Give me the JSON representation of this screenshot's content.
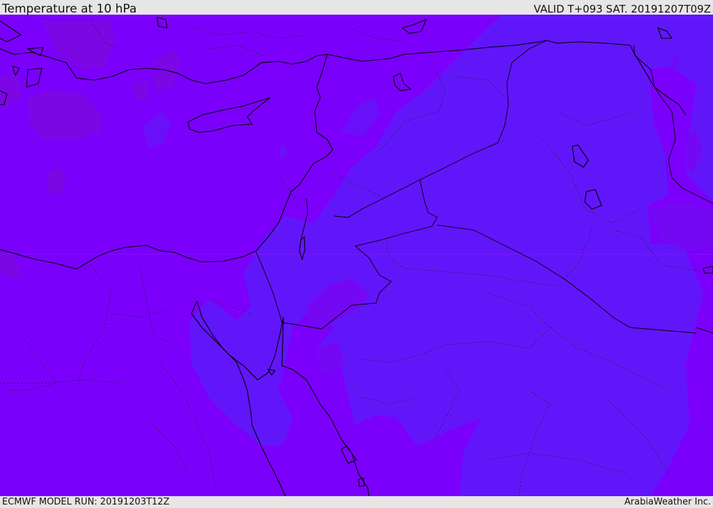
{
  "header": {
    "title": "Temperature at 10 hPa",
    "valid": "VALID T+093 SAT. 20191207T09Z"
  },
  "footer": {
    "model_run": "ECMWF MODEL RUN: 20191203T12Z",
    "credit": "ArabiaWeather Inc."
  },
  "colors": {
    "field_dominant": "#7b00fb",
    "field_secondary": "#6116f9",
    "field_warm_patch": "#7c06e4",
    "coastline": "#000000",
    "borders": "#1b1b40",
    "chrome": "#e6e6e6"
  }
}
